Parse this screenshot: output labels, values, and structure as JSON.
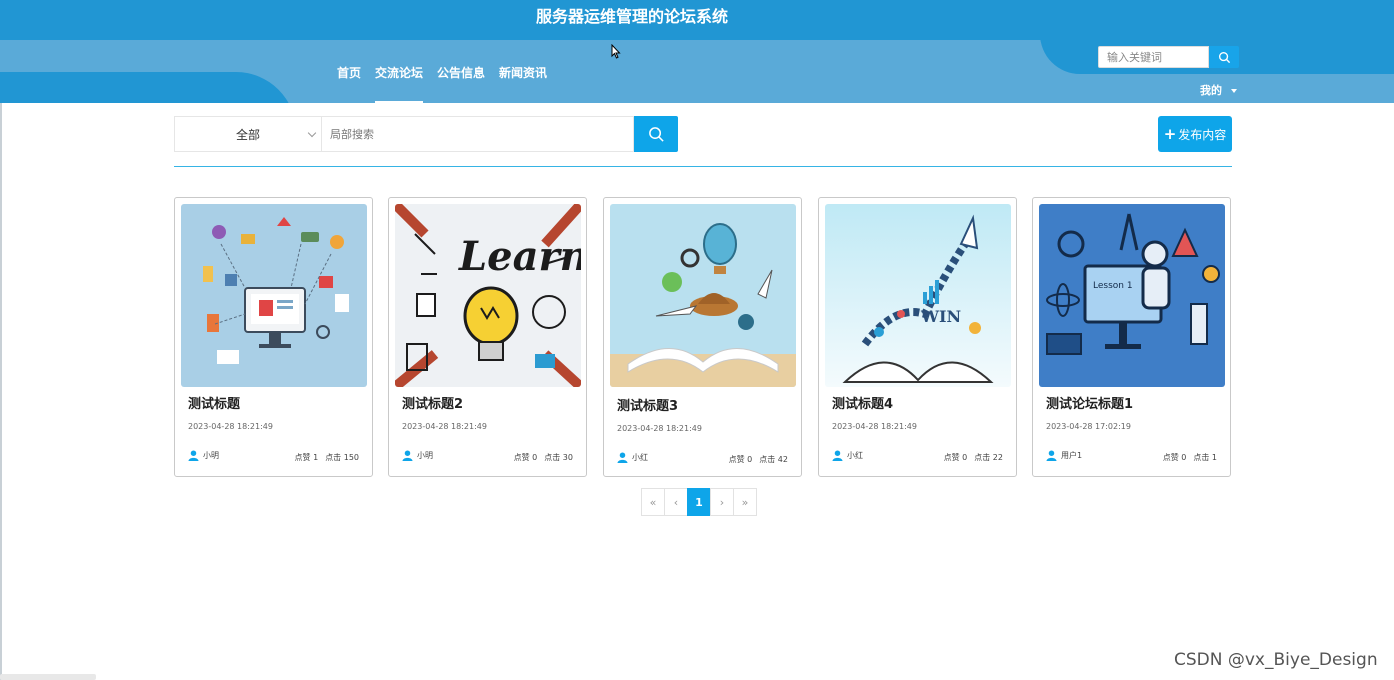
{
  "header": {
    "site_title": "服务器运维管理的论坛系统",
    "nav": [
      "首页",
      "交流论坛",
      "公告信息",
      "新闻资讯"
    ],
    "active_nav": "交流论坛",
    "search_placeholder": "输入关键词",
    "user_menu_label": "我的",
    "search_icon": "search-icon"
  },
  "filter": {
    "category_selected": "全部",
    "local_search_placeholder": "局部搜索",
    "publish_label": "发布内容",
    "accent_color": "#0ea5e9"
  },
  "posts": [
    {
      "title": "测试标题",
      "date": "2023-04-28 18:21:49",
      "author": "小明",
      "likes_label": "点赞 1",
      "clicks_label": "点击 150"
    },
    {
      "title": "测试标题2",
      "date": "2023-04-28 18:21:49",
      "author": "小明",
      "likes_label": "点赞 0",
      "clicks_label": "点击 30"
    },
    {
      "title": "测试标题3",
      "date": "2023-04-28 18:21:49",
      "author": "小红",
      "likes_label": "点赞 0",
      "clicks_label": "点击 42"
    },
    {
      "title": "测试标题4",
      "date": "2023-04-28 18:21:49",
      "author": "小红",
      "likes_label": "点赞 0",
      "clicks_label": "点击 22"
    },
    {
      "title": "测试论坛标题1",
      "date": "2023-04-28 17:02:19",
      "author": "用户1",
      "likes_label": "点赞 0",
      "clicks_label": "点击 1"
    }
  ],
  "thumb_text": {
    "learn": "Learn",
    "win": "WIN",
    "lesson": "Lesson 1"
  },
  "pagination": {
    "first": "«",
    "prev": "‹",
    "current": "1",
    "next": "›",
    "last": "»"
  },
  "watermark": "CSDN @vx_Biye_Design",
  "colors": {
    "header": "#2196d3",
    "nav_band": "#5aaad8",
    "primary": "#0ea5e9"
  }
}
